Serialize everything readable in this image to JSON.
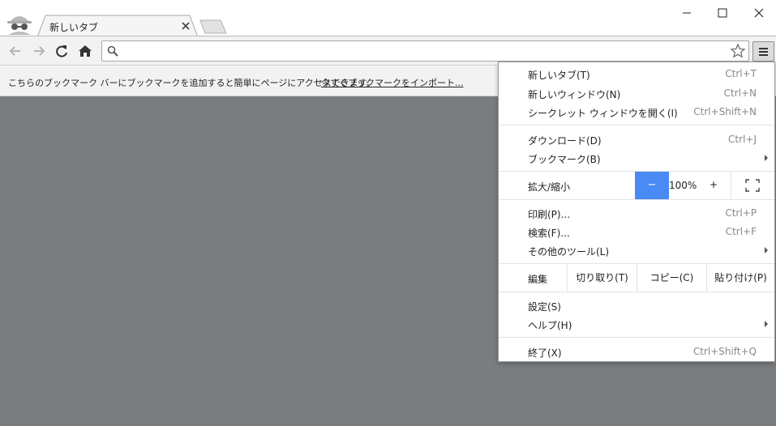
{
  "tab": {
    "title": "新しいタブ"
  },
  "bookmark_bar": {
    "message": "こちらのブックマーク バーにブックマークを追加すると簡単にページにアクセスできます。",
    "import_link": "今すぐブックマークをインポート..."
  },
  "colors": {
    "accent": "#4a8af4",
    "content_bg": "#797d80"
  },
  "menu": {
    "new_tab": {
      "label": "新しいタブ(T)",
      "shortcut": "Ctrl+T"
    },
    "new_window": {
      "label": "新しいウィンドウ(N)",
      "shortcut": "Ctrl+N"
    },
    "incognito": {
      "label": "シークレット ウィンドウを開く(I)",
      "shortcut": "Ctrl+Shift+N"
    },
    "downloads": {
      "label": "ダウンロード(D)",
      "shortcut": "Ctrl+J"
    },
    "bookmarks": {
      "label": "ブックマーク(B)"
    },
    "zoom": {
      "label": "拡大/縮小",
      "minus": "−",
      "value": "100%",
      "plus": "+"
    },
    "print": {
      "label": "印刷(P)...",
      "shortcut": "Ctrl+P"
    },
    "find": {
      "label": "検索(F)...",
      "shortcut": "Ctrl+F"
    },
    "more_tools": {
      "label": "その他のツール(L)"
    },
    "edit": {
      "label": "編集",
      "cut": "切り取り(T)",
      "copy": "コピー(C)",
      "paste": "貼り付け(P)"
    },
    "settings": {
      "label": "設定(S)"
    },
    "help": {
      "label": "ヘルプ(H)"
    },
    "exit": {
      "label": "終了(X)",
      "shortcut": "Ctrl+Shift+Q"
    }
  }
}
